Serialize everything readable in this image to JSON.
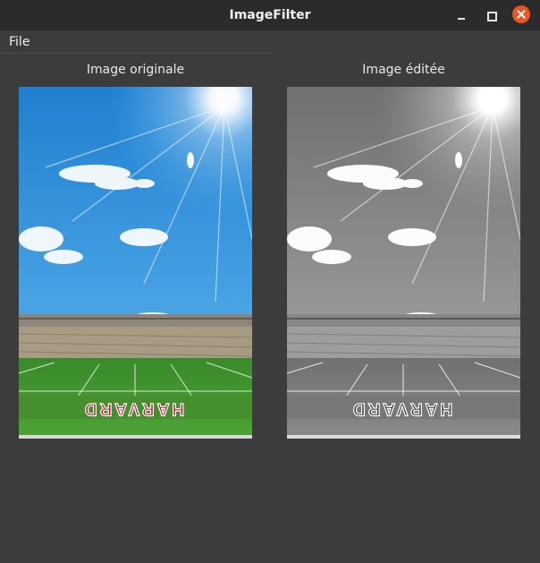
{
  "window": {
    "title": "ImageFilter"
  },
  "menu": {
    "file_label": "File"
  },
  "panels": {
    "original_label": "Image originale",
    "edited_label": "Image éditée"
  },
  "photo": {
    "stadium_text": "HARVARD"
  },
  "colors": {
    "close_button": "#e95420",
    "sky_top": "#1f7fd1",
    "sky_bottom": "#56b4ef",
    "field": "#3f8f2d",
    "endzone_letters": "#b5122f"
  },
  "icons": [
    "minimize-icon",
    "maximize-icon",
    "close-icon"
  ]
}
